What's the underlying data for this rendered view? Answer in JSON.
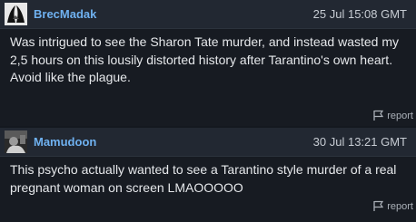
{
  "comments": [
    {
      "username": "BrecMadak",
      "date": "25 Jul 15:08 GMT",
      "lines": [
        "Was intrigued to see the Sharon Tate murder, and instead wasted my 2,5 hours on this lousily distorted history after Tarantino's own heart.",
        "Avoid like the plague."
      ],
      "report_label": "report",
      "avatar_icon": "bw-avatar-icon"
    },
    {
      "username": "Mamudoon",
      "date": "30 Jul 13:21 GMT",
      "lines": [
        "This psycho actually wanted to see a Tarantino style murder of a real pregnant woman on screen LMAOOOOO"
      ],
      "report_label": "report",
      "avatar_icon": "photo-avatar-icon"
    }
  ],
  "colors": {
    "username": "#6fb1f0",
    "header_bg": "#222832",
    "body_bg": "#171b22"
  }
}
